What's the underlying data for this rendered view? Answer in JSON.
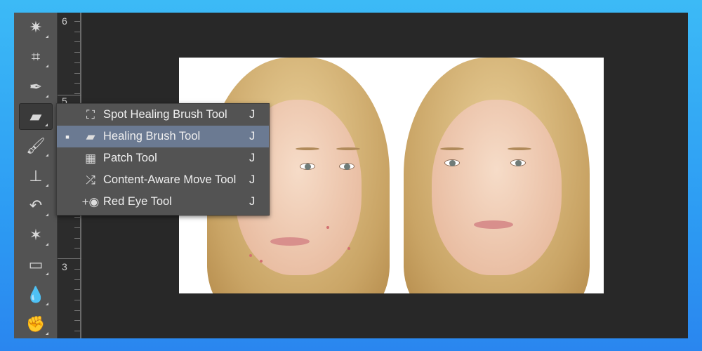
{
  "toolbar": {
    "tools": [
      {
        "name": "magic-wand",
        "glyph": "✷"
      },
      {
        "name": "crop",
        "glyph": "⌗"
      },
      {
        "name": "eyedropper",
        "glyph": "✒"
      },
      {
        "name": "healing-brush",
        "glyph": "▰"
      },
      {
        "name": "brush",
        "glyph": "🖌"
      },
      {
        "name": "clone-stamp",
        "glyph": "⊥"
      },
      {
        "name": "history-brush",
        "glyph": "↶"
      },
      {
        "name": "eraser",
        "glyph": "✶"
      },
      {
        "name": "gradient",
        "glyph": "▭"
      },
      {
        "name": "blur",
        "glyph": "💧"
      },
      {
        "name": "dodge",
        "glyph": "✊"
      }
    ],
    "active": "healing-brush"
  },
  "ruler": {
    "labels": [
      "6",
      "5",
      "3"
    ]
  },
  "menu": {
    "items": [
      {
        "label": "Spot Healing Brush Tool",
        "shortcut": "J",
        "icon": "spot-healing-brush-icon",
        "glyph": "⛶",
        "selected": false
      },
      {
        "label": "Healing Brush Tool",
        "shortcut": "J",
        "icon": "healing-brush-icon",
        "glyph": "▰",
        "selected": true,
        "marker": "■"
      },
      {
        "label": "Patch Tool",
        "shortcut": "J",
        "icon": "patch-icon",
        "glyph": "▦",
        "selected": false
      },
      {
        "label": "Content-Aware Move Tool",
        "shortcut": "J",
        "icon": "content-aware-move-icon",
        "glyph": "⤮",
        "selected": false
      },
      {
        "label": "Red Eye Tool",
        "shortcut": "J",
        "icon": "red-eye-icon",
        "glyph": "+◉",
        "selected": false
      }
    ]
  },
  "colors": {
    "highlight": "#6b7a92",
    "panel": "#535353",
    "canvas": "#282828"
  }
}
